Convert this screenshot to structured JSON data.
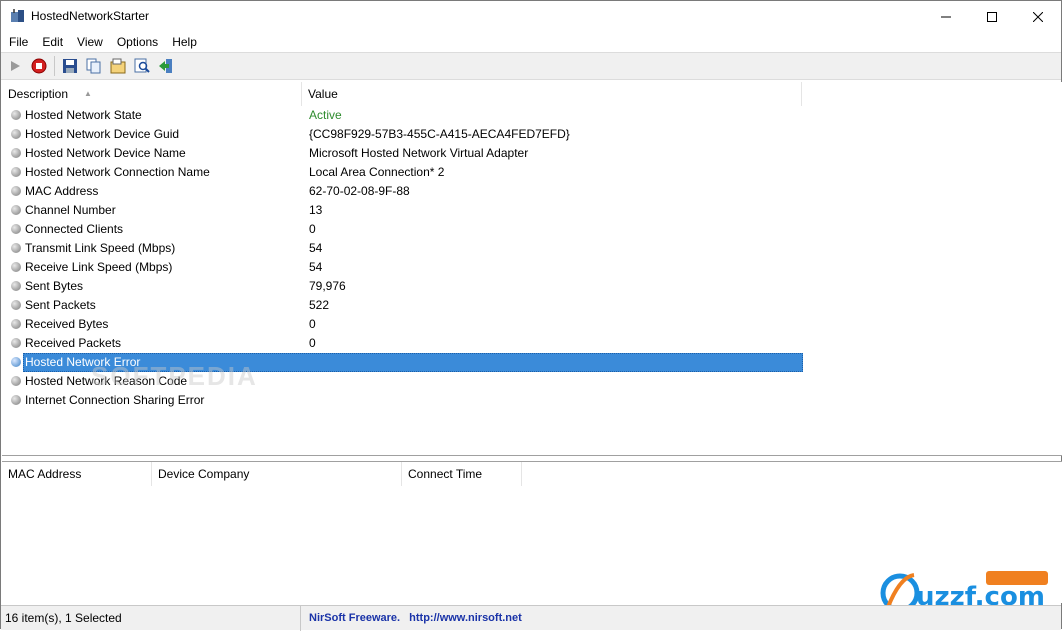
{
  "window": {
    "title": "HostedNetworkStarter"
  },
  "menu": [
    "File",
    "Edit",
    "View",
    "Options",
    "Help"
  ],
  "toolbar": {
    "buttons": [
      "start-icon",
      "stop-icon",
      "save-icon",
      "copy-icon",
      "properties-icon",
      "find-icon",
      "exit-icon"
    ]
  },
  "upper_list": {
    "columns": [
      "Description",
      "Value"
    ],
    "rows": [
      {
        "desc": "Hosted Network State",
        "value": "Active"
      },
      {
        "desc": "Hosted Network Device Guid",
        "value": "{CC98F929-57B3-455C-A415-AECA4FED7EFD}"
      },
      {
        "desc": "Hosted Network Device Name",
        "value": "Microsoft Hosted Network Virtual Adapter"
      },
      {
        "desc": "Hosted Network Connection Name",
        "value": "Local Area Connection* 2"
      },
      {
        "desc": "MAC Address",
        "value": "62-70-02-08-9F-88"
      },
      {
        "desc": "Channel Number",
        "value": "13"
      },
      {
        "desc": "Connected Clients",
        "value": "0"
      },
      {
        "desc": "Transmit Link Speed (Mbps)",
        "value": "54"
      },
      {
        "desc": "Receive Link Speed (Mbps)",
        "value": "54"
      },
      {
        "desc": "Sent Bytes",
        "value": "79,976"
      },
      {
        "desc": "Sent Packets",
        "value": "522"
      },
      {
        "desc": "Received Bytes",
        "value": "0"
      },
      {
        "desc": "Received Packets",
        "value": "0"
      },
      {
        "desc": "Hosted Network Error",
        "value": ""
      },
      {
        "desc": "Hosted Network Reason Code",
        "value": ""
      },
      {
        "desc": "Internet Connection Sharing Error",
        "value": ""
      }
    ],
    "selected_index": 13
  },
  "lower_list": {
    "columns": [
      "MAC Address",
      "Device Company",
      "Connect Time"
    ]
  },
  "status": {
    "items": "16 item(s), 1 Selected",
    "vendor": "NirSoft Freeware.",
    "url": "http://www.nirsoft.net"
  },
  "colors": {
    "active_value": "#2e8b2e",
    "selection": "#3b8bd9",
    "link": "#1a33a8"
  }
}
